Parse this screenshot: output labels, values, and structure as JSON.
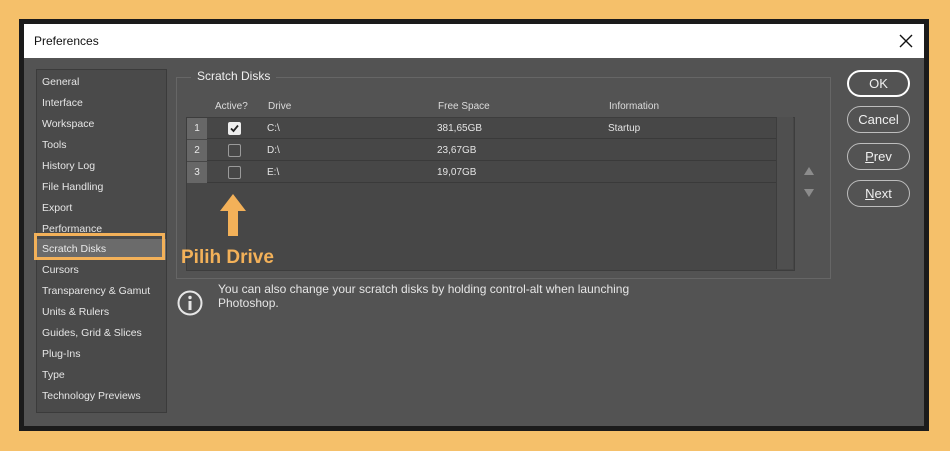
{
  "window": {
    "title": "Preferences"
  },
  "sidebar": {
    "items": [
      {
        "label": "General"
      },
      {
        "label": "Interface"
      },
      {
        "label": "Workspace"
      },
      {
        "label": "Tools"
      },
      {
        "label": "History Log"
      },
      {
        "label": "File Handling"
      },
      {
        "label": "Export"
      },
      {
        "label": "Performance"
      },
      {
        "label": "Scratch Disks",
        "selected": true
      },
      {
        "label": "Cursors"
      },
      {
        "label": "Transparency & Gamut"
      },
      {
        "label": "Units & Rulers"
      },
      {
        "label": "Guides, Grid & Slices"
      },
      {
        "label": "Plug-Ins"
      },
      {
        "label": "Type"
      },
      {
        "label": "Technology Previews"
      }
    ]
  },
  "scratch_disks": {
    "title": "Scratch Disks",
    "columns": {
      "active": "Active?",
      "drive": "Drive",
      "free_space": "Free Space",
      "information": "Information"
    },
    "rows": [
      {
        "num": "1",
        "active": true,
        "drive": "C:\\",
        "free_space": "381,65GB",
        "information": "Startup"
      },
      {
        "num": "2",
        "active": false,
        "drive": "D:\\",
        "free_space": "23,67GB",
        "information": ""
      },
      {
        "num": "3",
        "active": false,
        "drive": "E:\\",
        "free_space": "19,07GB",
        "information": ""
      }
    ]
  },
  "annotation": {
    "label": "Pilih Drive",
    "color": "#f3b159"
  },
  "info": {
    "text": "You can also change your scratch disks by holding control-alt when launching Photoshop."
  },
  "buttons": {
    "ok": "OK",
    "cancel": "Cancel",
    "prev_first": "P",
    "prev_rest": "rev",
    "next_first": "N",
    "next_rest": "ext"
  },
  "colors": {
    "background": "#f5c06a",
    "dialog": "#535353",
    "highlight": "#f3b159"
  }
}
